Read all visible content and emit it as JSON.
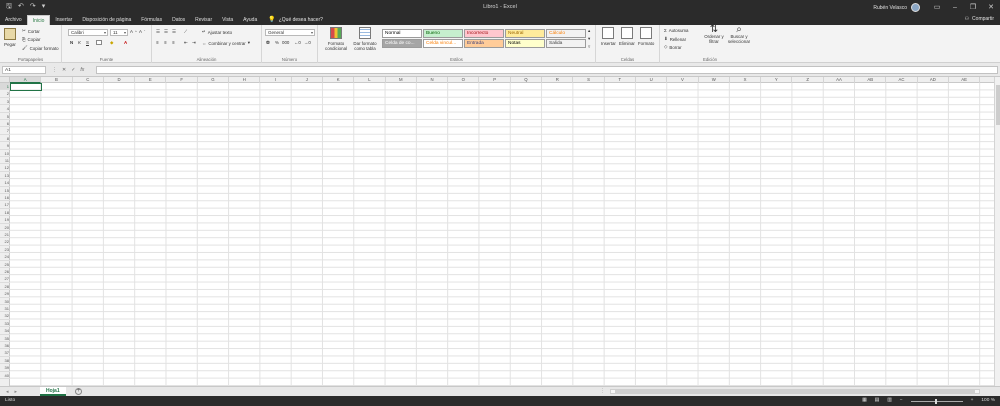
{
  "window": {
    "title": "Libro1 - Excel",
    "user_name": "Rubén Velasco",
    "qat": [
      "save-icon",
      "undo-icon",
      "redo-icon",
      "customize-icon"
    ],
    "controls": [
      "ribbon-display-icon",
      "minimize-icon",
      "restore-icon",
      "close-icon"
    ]
  },
  "tabs": [
    "Archivo",
    "Inicio",
    "Insertar",
    "Disposición de página",
    "Fórmulas",
    "Datos",
    "Revisar",
    "Vista",
    "Ayuda"
  ],
  "active_tab": "Inicio",
  "tell_me": "¿Qué desea hacer?",
  "share": "Compartir",
  "ribbon": {
    "clipboard": {
      "paste": "Pegar",
      "cut": "Cortar",
      "copy": "Copiar",
      "format_painter": "Copiar formato",
      "label": "Portapapeles"
    },
    "font": {
      "name": "Calibri",
      "size": "11",
      "bold": "N",
      "italic": "K",
      "underline": "S",
      "label": "Fuente"
    },
    "alignment": {
      "wrap": "Ajustar texto",
      "merge": "Combinar y centrar",
      "label": "Alineación"
    },
    "number": {
      "format": "General",
      "label": "Número"
    },
    "styles": {
      "conditional": "Formato condicional",
      "as_table": "Dar formato como tabla",
      "cells": [
        {
          "text": "Normal",
          "bg": "#ffffff",
          "fg": "#000000"
        },
        {
          "text": "Bueno",
          "bg": "#c6efce",
          "fg": "#006100"
        },
        {
          "text": "Incorrecto",
          "bg": "#ffc7ce",
          "fg": "#9c0006"
        },
        {
          "text": "Neutral",
          "bg": "#ffeb9c",
          "fg": "#9c6500"
        },
        {
          "text": "Cálculo",
          "bg": "#f2f2f2",
          "fg": "#fa7d00"
        },
        {
          "text": "Celda de co...",
          "bg": "#a5a5a5",
          "fg": "#ffffff"
        },
        {
          "text": "Celda vincul...",
          "bg": "#ffffff",
          "fg": "#fa7d00"
        },
        {
          "text": "Entrada",
          "bg": "#ffcc99",
          "fg": "#3f3f76"
        },
        {
          "text": "Notas",
          "bg": "#ffffcc",
          "fg": "#000000"
        },
        {
          "text": "Salida",
          "bg": "#f2f2f2",
          "fg": "#3f3f3f"
        }
      ],
      "label": "Estilos"
    },
    "cells_group": {
      "insert": "Insertar",
      "delete": "Eliminar",
      "format": "Formato",
      "label": "Celdas"
    },
    "editing": {
      "autosum": "Autosuma",
      "fill": "Rellenar",
      "clear": "Borrar",
      "sort": "Ordenar y filtrar",
      "find": "Buscar y seleccionar",
      "label": "Edición"
    }
  },
  "formula_bar": {
    "name_box": "A1",
    "fx": "fx",
    "value": ""
  },
  "grid": {
    "columns": [
      "A",
      "B",
      "C",
      "D",
      "E",
      "F",
      "G",
      "H",
      "I",
      "J",
      "K",
      "L",
      "M",
      "N",
      "O",
      "P",
      "Q",
      "R",
      "S",
      "T",
      "U",
      "V",
      "W",
      "X",
      "Y",
      "Z",
      "AA",
      "AB",
      "AC",
      "AD",
      "AE"
    ],
    "row_count": 40,
    "active_cell": "A1"
  },
  "sheets": [
    "Hoja1"
  ],
  "status": {
    "ready": "Listo",
    "zoom": "100 %"
  },
  "colors": {
    "accent": "#217346"
  }
}
